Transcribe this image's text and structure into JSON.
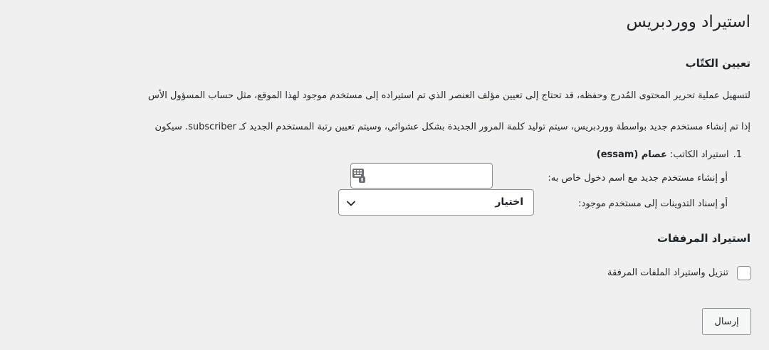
{
  "page": {
    "title": "استيراد ووردبريس"
  },
  "authors_section": {
    "title": "تعيين الكتّاب",
    "para1": "لتسهيل عملية تحرير المحتوى المُدرج وحفظه، قد تحتاج إلى تعيين مؤلف العنصر الذي تم استيراده إلى مستخدم موجود لهذا الموقع، مثل حساب المسؤول الأس",
    "para2": "إذا تم إنشاء مستخدم جديد بواسطة ووردبريس، سيتم توليد كلمة المرور الجديدة بشكل عشوائي، وسيتم تعيين رتبة المستخدم الجديد كـ subscriber. سيكون"
  },
  "author_item": {
    "number": "1.",
    "label": "استيراد الكاتب:",
    "name": "عصام (essam)",
    "new_user_label": "أو إنشاء مستخدم جديد مع اسم دخول خاص به:",
    "new_user_value": "",
    "existing_user_label": "أو إسناد التدوينات إلى مستخدم موجود:",
    "existing_user_selected": "اختيار"
  },
  "attachments_section": {
    "title": "استيراد المرفقات",
    "checkbox_label": "تنزيل واستيراد الملفات المرفقة",
    "checked": false
  },
  "submit": {
    "label": "إرسال"
  },
  "icons": {
    "keyboard": "keyboard-icon",
    "chevron": "chevron-down-icon"
  },
  "colors": {
    "background": "#f0f0f1",
    "text": "#1d2327",
    "border": "#8c8f94"
  }
}
